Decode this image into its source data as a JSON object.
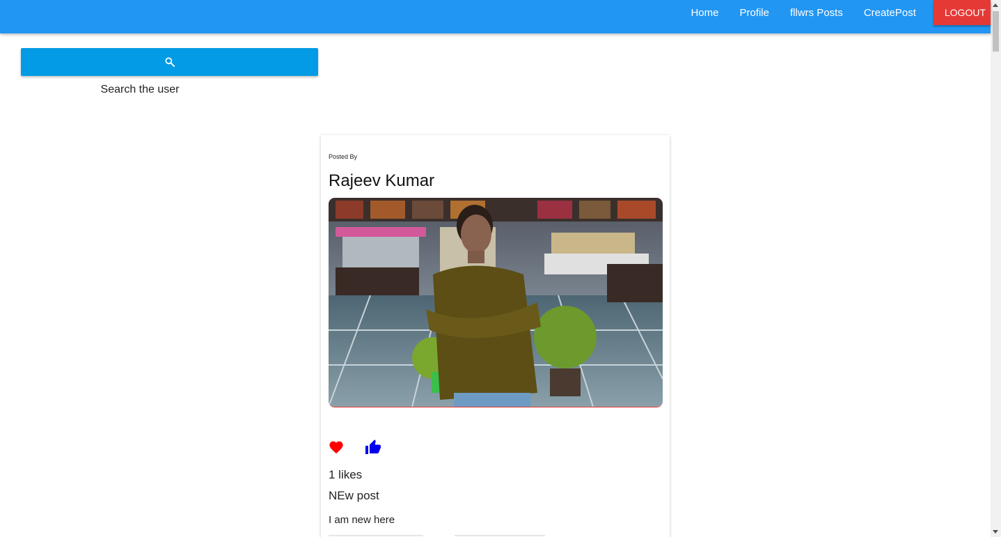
{
  "nav": {
    "links": [
      "Home",
      "Profile",
      "fllwrs Posts",
      "CreatePost"
    ],
    "logout": "LOGOUT",
    "colors": {
      "bar": "#2196f3",
      "logout": "#e53935"
    }
  },
  "search": {
    "icon": "search-icon",
    "label": "Search the user",
    "color": "#039be5"
  },
  "post": {
    "posted_by_label": "Posted By",
    "author": "Rajeev Kumar",
    "image_alt": "photo of a man in olive polo shirt standing with arms crossed in a restaurant",
    "likes_text": "1 likes",
    "title": "NEw post",
    "body": "I am new here",
    "icons": {
      "like": "heart-icon",
      "thumb": "thumb-up-icon"
    },
    "colors": {
      "heart": "#ff0000",
      "thumb": "#0000ee"
    }
  }
}
